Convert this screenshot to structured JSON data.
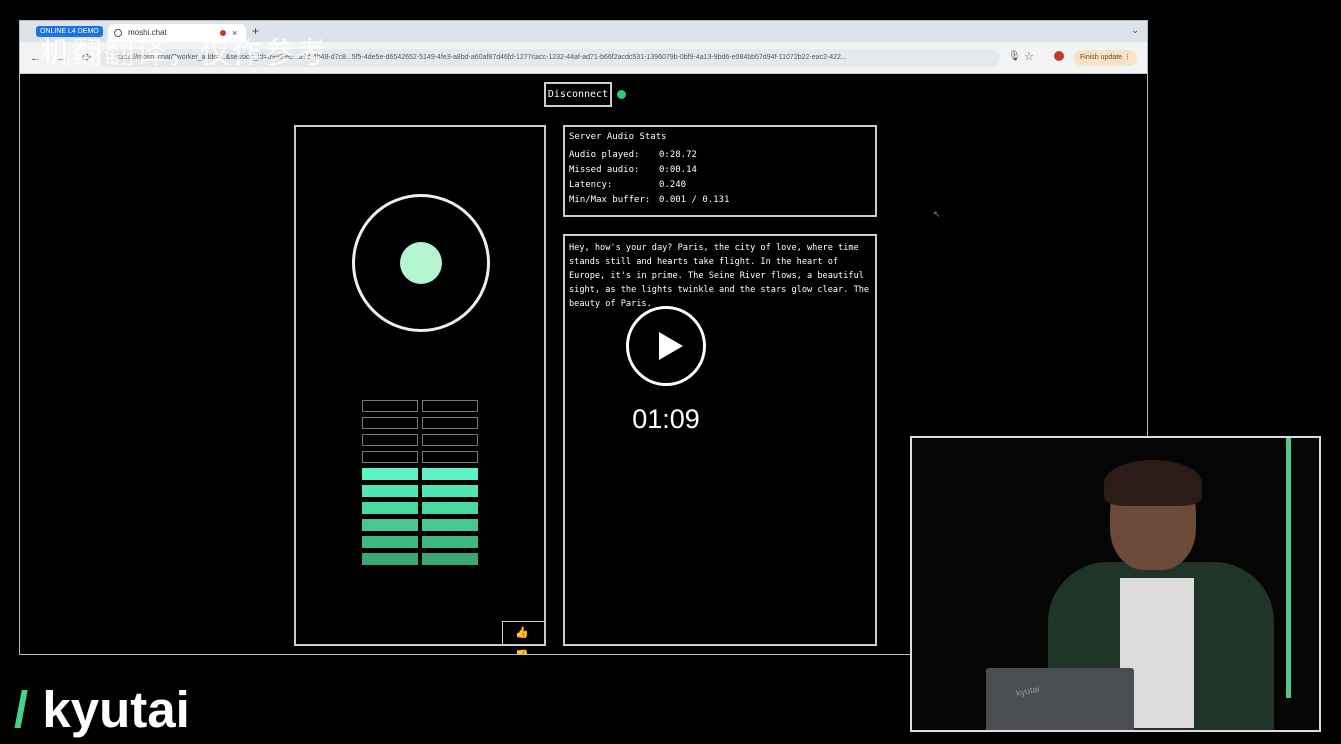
{
  "browser": {
    "tab_group_label": "ONLINE L4 DEMO",
    "tab_title": "moshi.chat",
    "tab_close": "×",
    "new_tab": "+",
    "window_controls": "⌄",
    "nav_buttons": "← → ⟳",
    "url": "https://moshi.chat/?worker_addr=...&session_id=0993-ee...a7d-4b48-d7c8...5f5-4de5e-d6542652-5149-4fe3-a8bd-a60af87d46fd-1277cacc-1232-44af-ad71-b66f2acdc531-1396079b-0bf9-4a13-9bd6-e084bb57d94f-11072b22-eac2-422...",
    "finish_update_label": "Finish update ⋮",
    "mic_icon": "🎙",
    "star_icon": "☆"
  },
  "watermark": "机翻翻译，仅作参考",
  "controls": {
    "disconnect_label": "Disconnect",
    "status_color": "#2ecc71"
  },
  "audio_meter": {
    "levels": 6,
    "total": 10
  },
  "feedback": {
    "icons": "👍 👎"
  },
  "stats": {
    "title": "Server Audio Stats",
    "rows": [
      {
        "label": "Audio played:",
        "value": "0:28.72"
      },
      {
        "label": "Missed audio:",
        "value": "0:00.14"
      },
      {
        "label": "Latency:",
        "value": "0.240"
      },
      {
        "label": "Min/Max buffer:",
        "value": "0.001 / 0.131"
      }
    ]
  },
  "transcript": {
    "text": "Hey, how's your day? Paris, the city of love, where time stands still and hearts take flight. In the heart of Europe, it's in prime. The Seine River flows, a beautiful sight, as the lights twinkle and the stars glow clear. The beauty of Paris."
  },
  "video": {
    "timestamp": "01:09",
    "laptop_brand": "kyutai"
  },
  "brand": {
    "slash": "/",
    "name": "kyutai",
    "accent_color": "#45d28a"
  },
  "icons": {
    "cursor": "↖"
  }
}
